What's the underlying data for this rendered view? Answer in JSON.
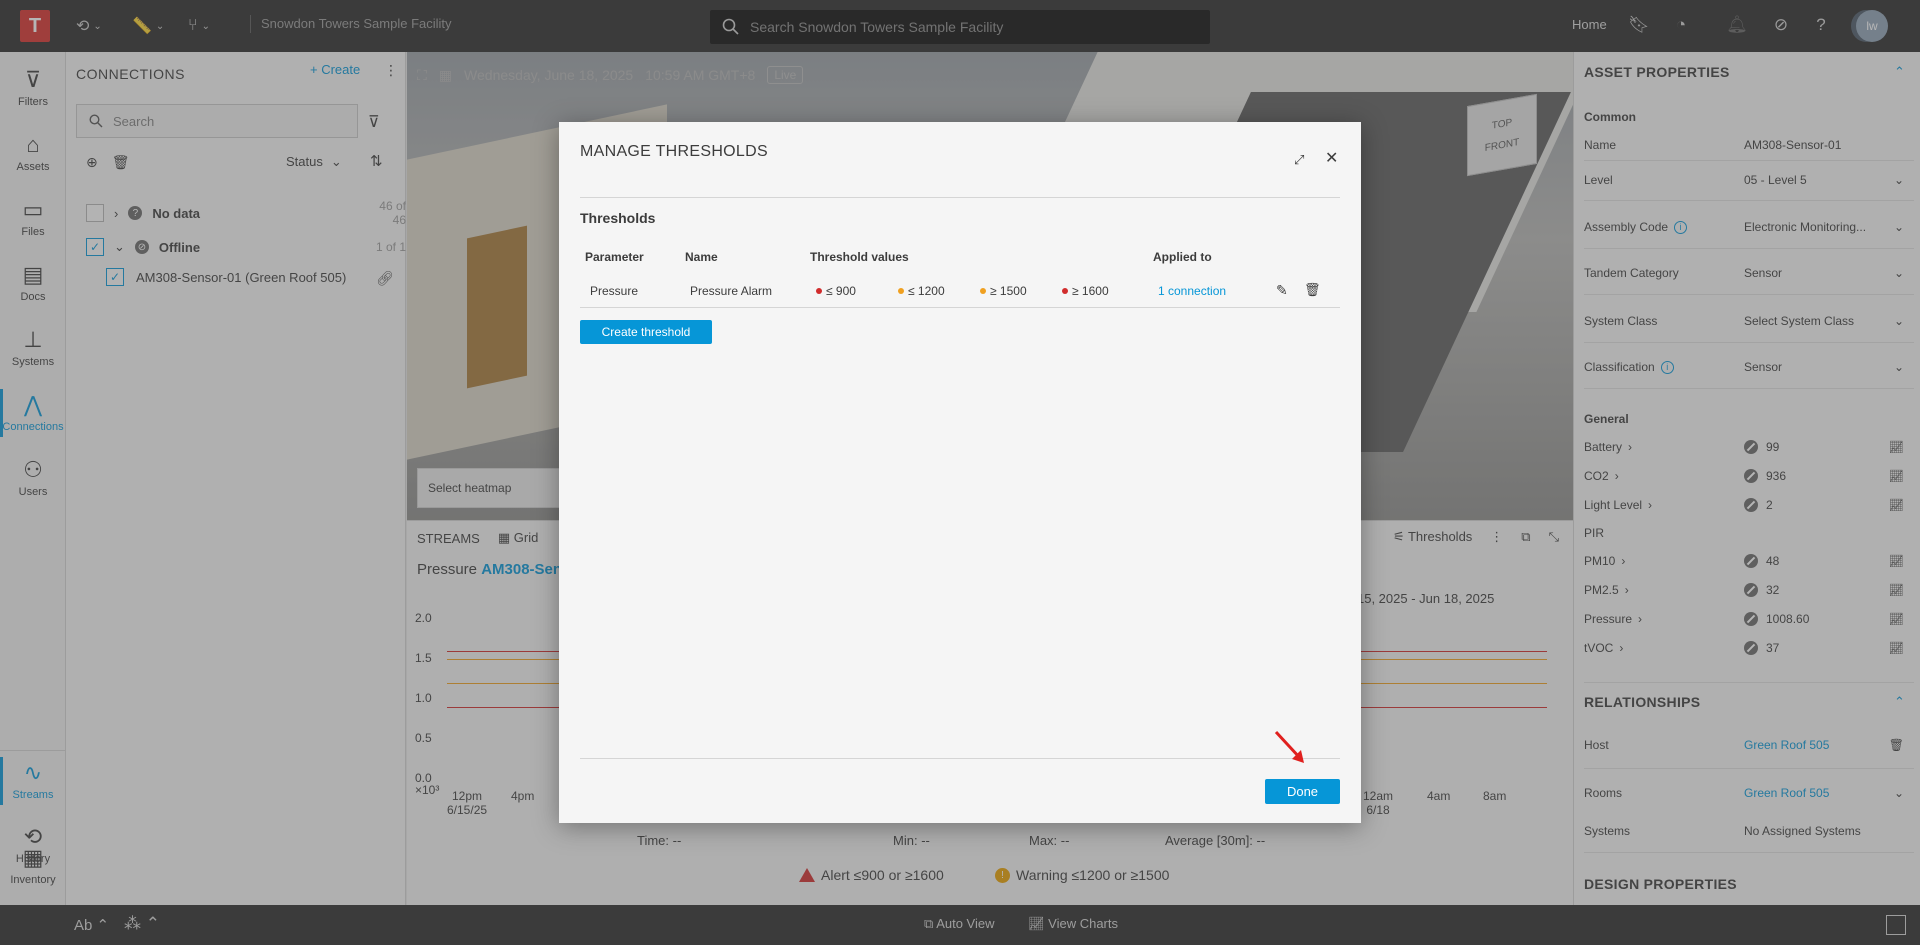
{
  "topbar": {
    "logo": "T",
    "facility": "Snowdon Towers Sample Facility",
    "search_placeholder": "Search Snowdon Towers Sample Facility",
    "home": "Home",
    "avatar": "lw"
  },
  "leftnav": {
    "items": [
      {
        "label": "Filters",
        "icon": "filter-icon"
      },
      {
        "label": "Assets",
        "icon": "tag-icon"
      },
      {
        "label": "Files",
        "icon": "folder-icon"
      },
      {
        "label": "Docs",
        "icon": "docs-icon"
      },
      {
        "label": "Systems",
        "icon": "systems-icon"
      },
      {
        "label": "Connections",
        "icon": "connections-icon"
      },
      {
        "label": "Users",
        "icon": "users-icon"
      }
    ],
    "bottom": [
      {
        "label": "Streams",
        "icon": "streams-icon"
      },
      {
        "label": "History",
        "icon": "history-icon"
      },
      {
        "label": "Inventory",
        "icon": "inventory-icon"
      }
    ]
  },
  "connections": {
    "title": "CONNECTIONS",
    "create": "Create",
    "search_placeholder": "Search",
    "sort": "Status",
    "groups": [
      {
        "label": "No data",
        "count": "46 of 46"
      },
      {
        "label": "Offline",
        "count": "1 of 1"
      }
    ],
    "sensor": "AM308-Sensor-01 (Green Roof 505)"
  },
  "viewport": {
    "date": "Wednesday, June 18, 2025",
    "time": "10:59 AM GMT+8",
    "live": "Live",
    "heatmap": "Select heatmap",
    "cube_top": "TOP",
    "cube_front": "FRONT"
  },
  "streams": {
    "tab": "STREAMS",
    "grid": "Grid",
    "thresholds": "Thresholds",
    "chart_title_prefix": "Pressure",
    "chart_title_link": "AM308-Sens",
    "range": "15, 2025 - Jun 18, 2025",
    "y_ticks": [
      "2.0",
      "1.5",
      "1.0",
      "0.5",
      "0.0"
    ],
    "y_exp": "×10³",
    "x_left": [
      {
        "t": "12pm",
        "s": "6/15/25"
      },
      {
        "t": "4pm",
        "s": ""
      }
    ],
    "x_right": [
      {
        "t": "12am",
        "s": "6/18"
      },
      {
        "t": "4am",
        "s": ""
      },
      {
        "t": "8am",
        "s": ""
      }
    ],
    "time_label": "Time:",
    "time_val": "--",
    "min_label": "Min:",
    "min_val": "--",
    "max_label": "Max:",
    "max_val": "--",
    "avg_label": "Average [30m]:",
    "avg_val": "--",
    "alert": "Alert ≤900 or ≥1600",
    "warning": "Warning ≤1200 or ≥1500"
  },
  "properties": {
    "title": "ASSET PROPERTIES",
    "common": "Common",
    "common_rows": [
      {
        "k": "Name",
        "v": "AM308-Sensor-01",
        "drop": false,
        "info": false
      },
      {
        "k": "Level",
        "v": "05 - Level 5",
        "drop": true,
        "info": false
      },
      {
        "k": "Assembly Code",
        "v": "Electronic Monitoring...",
        "drop": true,
        "info": true
      },
      {
        "k": "Tandem Category",
        "v": "Sensor",
        "drop": true,
        "info": false
      },
      {
        "k": "System Class",
        "v": "Select System Class",
        "drop": true,
        "info": false
      },
      {
        "k": "Classification",
        "v": "Sensor",
        "drop": true,
        "info": true
      }
    ],
    "general": "General",
    "general_rows": [
      {
        "k": "Battery",
        "v": "99"
      },
      {
        "k": "CO2",
        "v": "936"
      },
      {
        "k": "Light Level",
        "v": "2"
      },
      {
        "k": "PIR",
        "v": ""
      },
      {
        "k": "PM10",
        "v": "48"
      },
      {
        "k": "PM2.5",
        "v": "32"
      },
      {
        "k": "Pressure",
        "v": "1008.60"
      },
      {
        "k": "tVOC",
        "v": "37"
      }
    ],
    "relationships": "RELATIONSHIPS",
    "host_k": "Host",
    "host_v": "Green Roof 505",
    "rooms_k": "Rooms",
    "rooms_v": "Green Roof 505",
    "systems_k": "Systems",
    "systems_v": "No Assigned Systems",
    "design": "DESIGN PROPERTIES"
  },
  "bottombar": {
    "ab": "Ab",
    "auto_view": "Auto View",
    "view_charts": "View Charts"
  },
  "modal": {
    "title": "MANAGE THRESHOLDS",
    "section": "Thresholds",
    "columns": {
      "parameter": "Parameter",
      "name": "Name",
      "values": "Threshold values",
      "applied": "Applied to"
    },
    "row": {
      "parameter": "Pressure",
      "name": "Pressure Alarm",
      "values": [
        {
          "text": "≤ 900",
          "color": "#d12c2c"
        },
        {
          "text": "≤ 1200",
          "color": "#f0a020"
        },
        {
          "text": "≥ 1500",
          "color": "#f0a020"
        },
        {
          "text": "≥ 1600",
          "color": "#d12c2c"
        }
      ],
      "applied": "1 connection"
    },
    "create": "Create threshold",
    "done": "Done"
  },
  "colors": {
    "accent": "#0696d7",
    "alert": "#d12c2c",
    "warning": "#f0a020"
  }
}
